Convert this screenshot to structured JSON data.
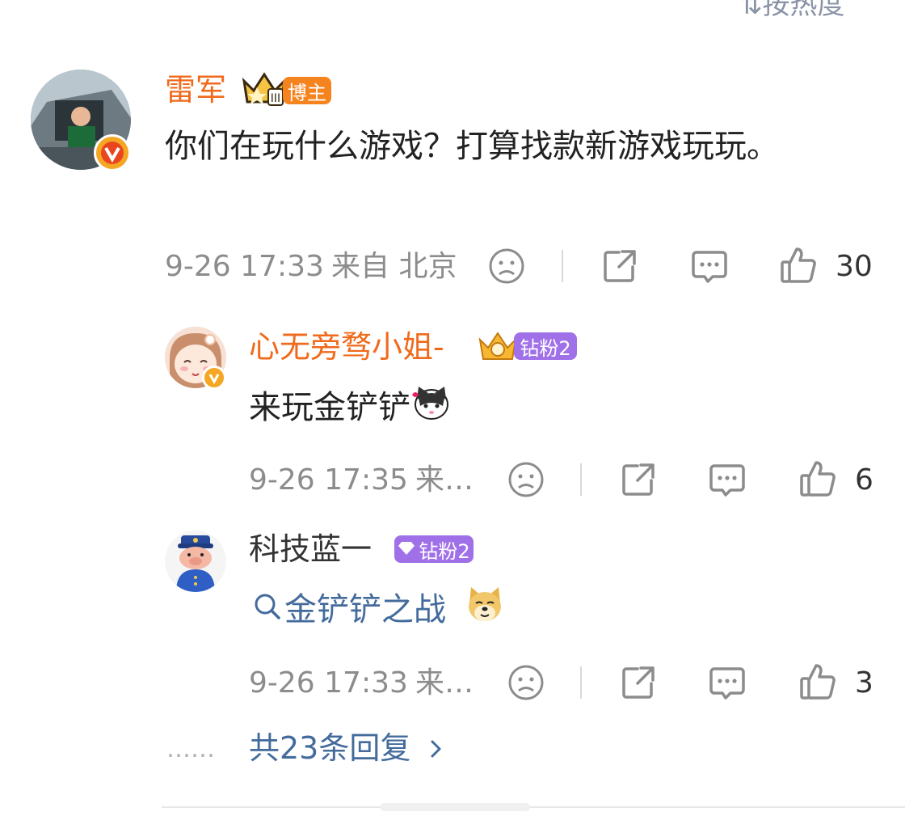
{
  "header": {
    "sort_label": "按热度"
  },
  "main_comment": {
    "username": "雷军",
    "badge": "博主",
    "text": "你们在玩什么游戏？打算找款新游戏玩玩。",
    "time": "9-26 17:33",
    "location": "来自 北京",
    "likes": "30",
    "icons": [
      "dislike-face-icon",
      "share-icon",
      "comment-icon",
      "like-thumb-icon"
    ]
  },
  "replies": [
    {
      "username": "心无旁骛小姐-",
      "badge": "钻粉2",
      "text": "来玩金铲铲",
      "time": "9-26 17:35",
      "location": "来…",
      "likes": "6"
    },
    {
      "username": "科技蓝一",
      "badge": "钻粉2",
      "link_text": "金铲铲之战",
      "time": "9-26 17:33",
      "location": "来…",
      "likes": "3"
    }
  ],
  "more_replies": {
    "dots": "……",
    "label": "共23条回复"
  },
  "colors": {
    "accent": "#f06a1c",
    "link": "#436b9c",
    "badge_orange": "#f5841f",
    "badge_purple": "#a070e8"
  }
}
